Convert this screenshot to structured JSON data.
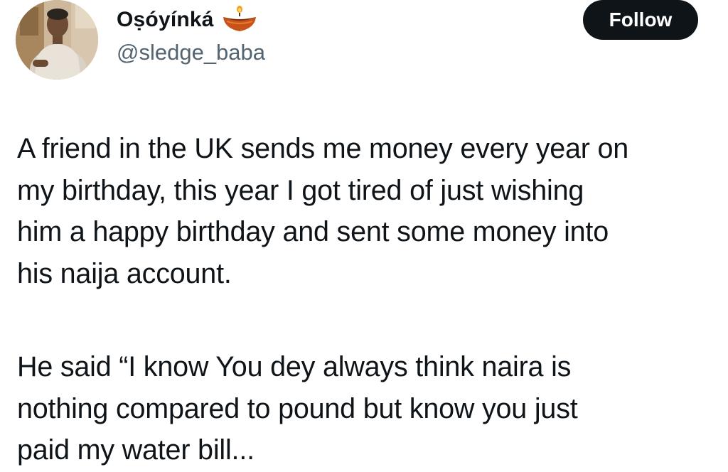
{
  "author": {
    "display_name": "Oṣóyínká",
    "handle": "@sledge_baba",
    "name_emoji": "oil-lamp-icon"
  },
  "follow_button": {
    "label": "Follow"
  },
  "tweet": {
    "paragraph_1": "A friend in the UK sends me money every year on\nmy birthday, this year I got tired of just wishing\nhim a happy birthday and sent some money into\nhis naija account.",
    "paragraph_2": "He said “I know You dey always think naira is\nnothing compared to pound but know you just\npaid my water bill..."
  },
  "colors": {
    "text": "#0f1419",
    "secondary_text": "#536471",
    "button_bg": "#0f1419",
    "button_text": "#ffffff",
    "background": "#ffffff"
  }
}
